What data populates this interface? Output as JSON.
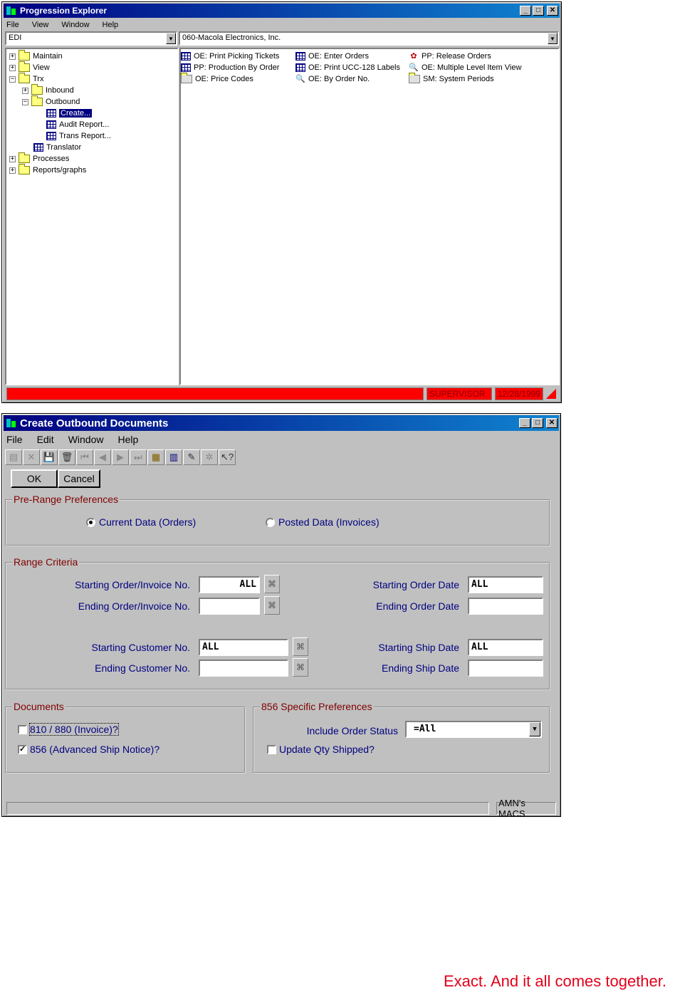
{
  "explorer": {
    "title": "Progression Explorer",
    "menu": [
      "File",
      "View",
      "Window",
      "Help"
    ],
    "left_combo": "EDI",
    "right_combo": "060-Macola Electronics, Inc.",
    "tree": [
      {
        "label": "Maintain",
        "expander": "+"
      },
      {
        "label": "View",
        "expander": "+"
      },
      {
        "label": "Trx",
        "expander": "−"
      },
      {
        "label": "Inbound",
        "expander": "+"
      },
      {
        "label": "Outbound",
        "expander": "−"
      },
      {
        "label": "Create..."
      },
      {
        "label": "Audit Report..."
      },
      {
        "label": "Trans Report..."
      },
      {
        "label": "Translator"
      },
      {
        "label": "Processes",
        "expander": "+"
      },
      {
        "label": "Reports/graphs",
        "expander": "+"
      }
    ],
    "shortcuts": [
      {
        "label": "OE: Print Picking Tickets",
        "icon": "grid-icon"
      },
      {
        "label": "PP: Production By Order",
        "icon": "grid-icon"
      },
      {
        "label": "OE: Price Codes",
        "icon": "folder-icon"
      },
      {
        "label": "OE: Enter Orders",
        "icon": "grid-icon"
      },
      {
        "label": "OE: Print UCC-128 Labels",
        "icon": "grid-icon"
      },
      {
        "label": "OE: By Order No.",
        "icon": "magnifier-icon"
      },
      {
        "label": "PP: Release Orders",
        "icon": "gear-icon"
      },
      {
        "label": "OE: Multiple Level Item View",
        "icon": "magnifier-icon"
      },
      {
        "label": "SM: System Periods",
        "icon": "folder-icon"
      }
    ],
    "status_user": "SUPERVISOR",
    "status_date": "12/28/1999"
  },
  "dialog": {
    "title": "Create Outbound Documents",
    "menu": [
      "File",
      "Edit",
      "Window",
      "Help"
    ],
    "ok_label": "OK",
    "cancel_label": "Cancel",
    "pre_range_legend": "Pre-Range Preferences",
    "radio_current": "Current Data (Orders)",
    "radio_posted": "Posted Data (Invoices)",
    "range_legend": "Range Criteria",
    "starting_order_label": "Starting Order/Invoice No.",
    "starting_order_value": "ALL",
    "ending_order_label": "Ending Order/Invoice No.",
    "ending_order_value": "",
    "starting_order_date_label": "Starting Order Date",
    "starting_order_date_value": "ALL",
    "ending_order_date_label": "Ending Order Date",
    "ending_order_date_value": "",
    "starting_customer_label": "Starting Customer No.",
    "starting_customer_value": "ALL",
    "ending_customer_label": "Ending Customer No.",
    "ending_customer_value": "",
    "starting_ship_date_label": "Starting Ship Date",
    "starting_ship_date_value": "ALL",
    "ending_ship_date_label": "Ending Ship Date",
    "ending_ship_date_value": "",
    "documents_legend": "Documents",
    "doc_810": "810 / 880 (Invoice)?",
    "doc_856": "856 (Advanced Ship Notice)?",
    "prefs_legend": "856 Specific Preferences",
    "include_status_label": "Include Order Status",
    "include_status_value": "=All",
    "update_qty_label": "Update Qty Shipped?",
    "status_right": "AMN's MACS"
  },
  "tagline": "Exact. And it all comes together."
}
